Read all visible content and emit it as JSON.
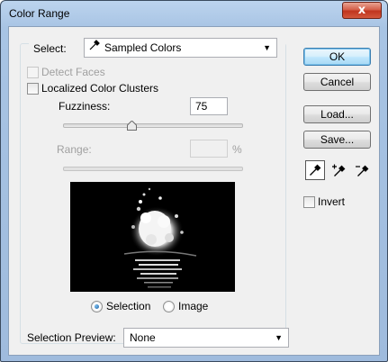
{
  "window": {
    "title": "Color Range",
    "close_glyph": "x"
  },
  "select": {
    "label": "Select:",
    "value": "Sampled Colors",
    "icon": "eyedropper-icon"
  },
  "options": {
    "detect_faces": {
      "label": "Detect Faces",
      "checked": false,
      "disabled": true
    },
    "localized_clusters": {
      "label": "Localized Color Clusters",
      "checked": false
    }
  },
  "fuzziness": {
    "label": "Fuzziness:",
    "value": "75",
    "slider_fraction": 0.38
  },
  "range": {
    "label": "Range:",
    "value": "",
    "unit": "%",
    "disabled": true
  },
  "preview_mode": {
    "options": [
      "Selection",
      "Image"
    ],
    "selected": "Selection"
  },
  "selection_preview": {
    "label": "Selection Preview:",
    "value": "None"
  },
  "buttons": {
    "ok": "OK",
    "cancel": "Cancel",
    "load": "Load...",
    "save": "Save..."
  },
  "tools": [
    "eyedropper-icon",
    "eyedropper-plus-icon",
    "eyedropper-minus-icon"
  ],
  "invert": {
    "label": "Invert",
    "checked": false
  }
}
